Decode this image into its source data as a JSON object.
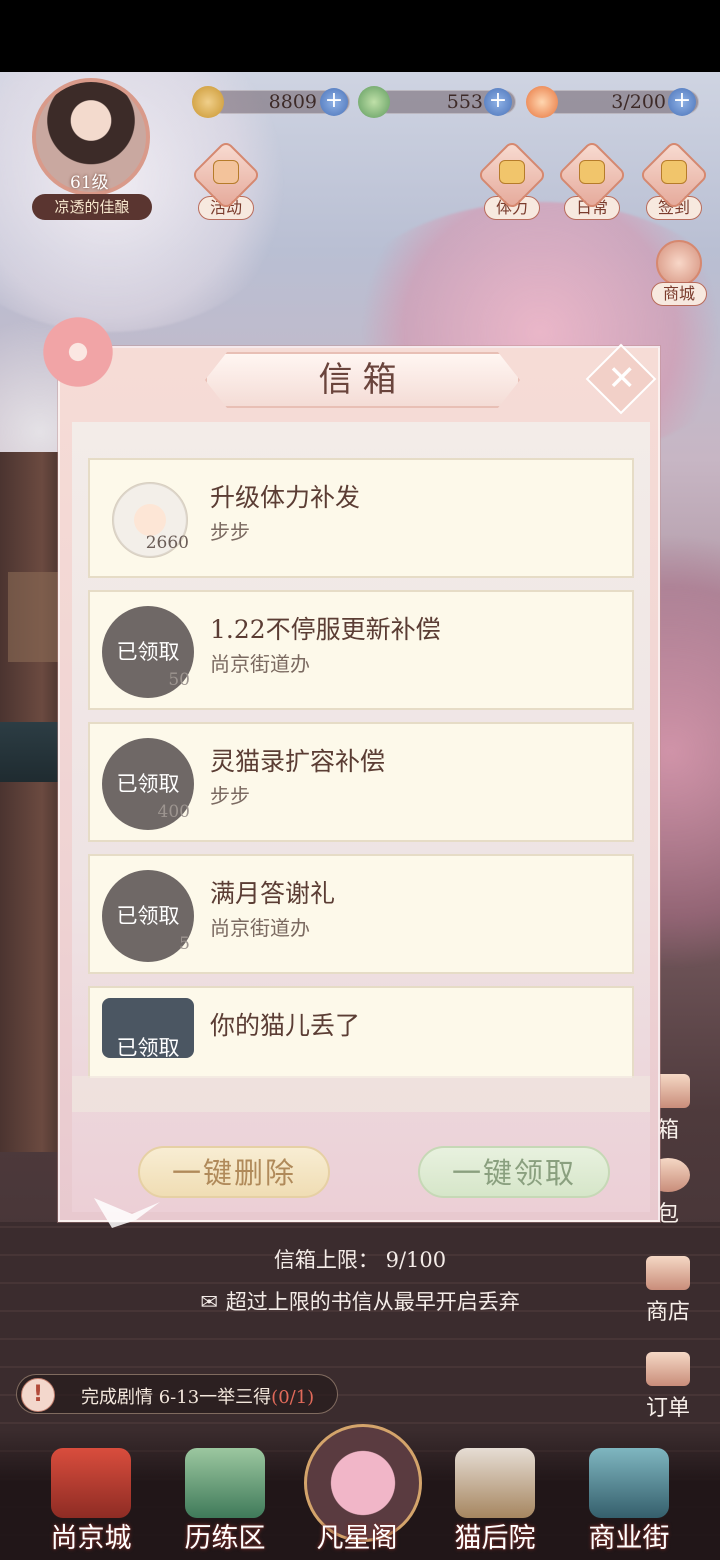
{
  "player": {
    "level": "61级",
    "name": "凉透的佳酿"
  },
  "resources": [
    {
      "icon": "paw-coin-icon",
      "value": "8809"
    },
    {
      "icon": "jade-icon",
      "value": "553"
    },
    {
      "icon": "stamina-bun-icon",
      "value": "3/200"
    }
  ],
  "hud_buttons": {
    "activity": "活动",
    "stamina": "体力",
    "daily": "日常",
    "checkin": "签到",
    "mall": "商城"
  },
  "mailbox": {
    "title": "信箱",
    "close_symbol": "✕",
    "mails": [
      {
        "subject": "升级体力补发",
        "sender": "步步",
        "qty": "2660",
        "claimed_label": ""
      },
      {
        "subject": "1.22不停服更新补偿",
        "sender": "尚京街道办",
        "qty": "50",
        "claimed_label": "已领取"
      },
      {
        "subject": "灵猫录扩容补偿",
        "sender": "步步",
        "qty": "400",
        "claimed_label": "已领取"
      },
      {
        "subject": "满月答谢礼",
        "sender": "尚京街道办",
        "qty": "5",
        "claimed_label": "已领取"
      },
      {
        "subject": "你的猫儿丢了",
        "sender": "",
        "qty": "",
        "claimed_label": "已领取"
      }
    ],
    "delete_all": "一键删除",
    "claim_all": "一键领取",
    "capacity_label": "信箱上限：",
    "capacity_value": "9/100",
    "overflow_note": "超过上限的书信从最早开启丢弃"
  },
  "side_buttons": {
    "mailbox": "箱",
    "bag": "包",
    "shop": "商店",
    "orders": "订单"
  },
  "quest": {
    "text": "完成剧情 6-13一举三得",
    "progress": "(0/1)"
  },
  "nav": [
    "尚京城",
    "历练区",
    "凡星阁",
    "猫后院",
    "商业街"
  ]
}
